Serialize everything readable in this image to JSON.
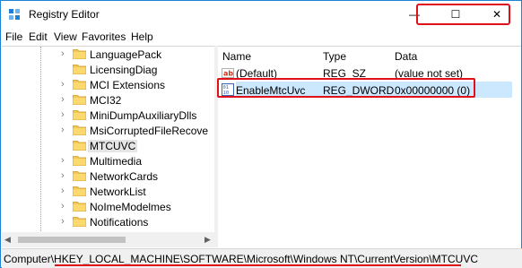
{
  "window": {
    "title": "Registry Editor",
    "controls": {
      "minimize": "—",
      "maximize": "☐",
      "close": "✕"
    }
  },
  "menu": [
    "File",
    "Edit",
    "View",
    "Favorites",
    "Help"
  ],
  "tree": {
    "items": [
      {
        "label": "LanguagePack",
        "expandable": true
      },
      {
        "label": "LicensingDiag",
        "expandable": false
      },
      {
        "label": "MCI Extensions",
        "expandable": true
      },
      {
        "label": "MCI32",
        "expandable": true
      },
      {
        "label": "MiniDumpAuxiliaryDlls",
        "expandable": true
      },
      {
        "label": "MsiCorruptedFileRecove",
        "expandable": true
      },
      {
        "label": "MTCUVC",
        "expandable": false,
        "selected": true
      },
      {
        "label": "Multimedia",
        "expandable": true
      },
      {
        "label": "NetworkCards",
        "expandable": true
      },
      {
        "label": "NetworkList",
        "expandable": true
      },
      {
        "label": "NoImeModelmes",
        "expandable": true
      },
      {
        "label": "Notifications",
        "expandable": true
      }
    ],
    "chevron": "›"
  },
  "list": {
    "columns": {
      "name": "Name",
      "type": "Type",
      "data": "Data"
    },
    "rows": [
      {
        "icon": "string-value-icon",
        "name": "(Default)",
        "type": "REG_SZ",
        "data": "(value not set)"
      },
      {
        "icon": "dword-value-icon",
        "name": "EnableMtcUvc",
        "type": "REG_DWORD",
        "data": "0x00000000 (0)",
        "selected": true
      }
    ]
  },
  "statusbar": {
    "path": "Computer\\HKEY_LOCAL_MACHINE\\SOFTWARE\\Microsoft\\Windows NT\\CurrentVersion\\MTCUVC"
  },
  "scroll": {
    "left": "◀",
    "right": "▶"
  },
  "colors": {
    "accent": "#1883d7",
    "highlight": "#e0101a",
    "selection": "#cce8ff"
  }
}
